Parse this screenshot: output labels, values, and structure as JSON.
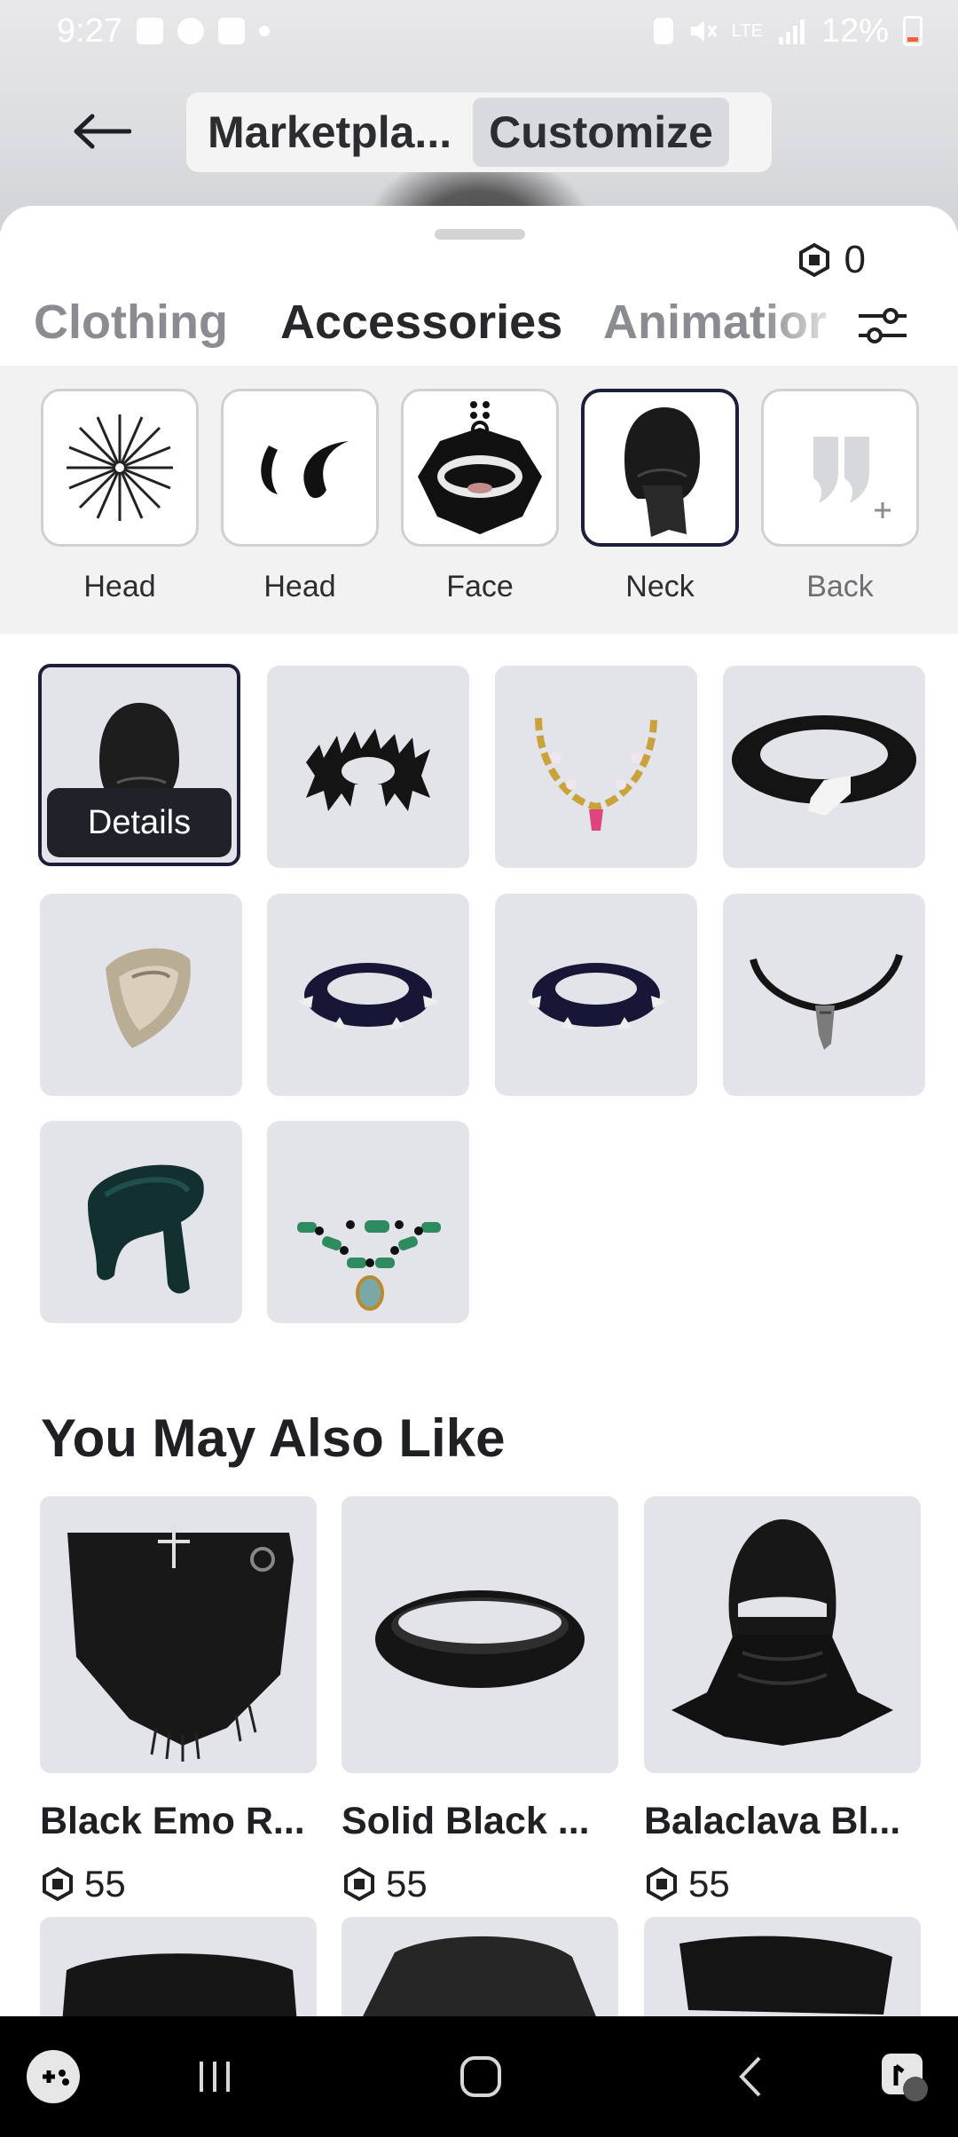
{
  "status_bar": {
    "time": "9:27",
    "battery": "12%",
    "network": "LTE"
  },
  "header": {
    "segments": [
      {
        "label": "Marketpla...",
        "active": false
      },
      {
        "label": "Customize",
        "active": true
      }
    ]
  },
  "balance": {
    "robux": "0"
  },
  "tabs": [
    {
      "label": "Clothing",
      "active": false
    },
    {
      "label": "Accessories",
      "active": true
    },
    {
      "label": "Animatior",
      "active": false
    }
  ],
  "categories": [
    {
      "label": "Head",
      "icon": "spiky-hair-icon",
      "selected": false
    },
    {
      "label": "Head",
      "icon": "horns-icon",
      "selected": false
    },
    {
      "label": "Face",
      "icon": "fanged-mask-icon",
      "selected": false
    },
    {
      "label": "Neck",
      "icon": "black-hood-icon",
      "selected": true
    },
    {
      "label": "Back",
      "icon": "wings-placeholder-icon",
      "selected": false
    }
  ],
  "owned_items": [
    {
      "icon": "black-hood-icon",
      "selected": true,
      "button": "Details"
    },
    {
      "icon": "fur-collar-icon"
    },
    {
      "icon": "gold-chain-necklace-icon"
    },
    {
      "icon": "black-belt-collar-icon"
    },
    {
      "icon": "tan-scarf-icon"
    },
    {
      "icon": "spiked-collar-icon"
    },
    {
      "icon": "spiked-collar-icon"
    },
    {
      "icon": "pendant-necklace-icon"
    },
    {
      "icon": "teal-scarf-icon"
    },
    {
      "icon": "jade-bead-necklace-icon"
    }
  ],
  "recommendations": {
    "title": "You May Also Like",
    "items": [
      {
        "name": "Black Emo R...",
        "price": "55",
        "icon": "emo-scarf-icon"
      },
      {
        "name": "Solid Black ...",
        "price": "55",
        "icon": "black-band-icon"
      },
      {
        "name": "Balaclava Bl...",
        "price": "55",
        "icon": "balaclava-icon"
      }
    ]
  },
  "colors": {
    "accent": "#1b1f3a",
    "tile": "#e3e4e9",
    "text": "#1f2024"
  }
}
